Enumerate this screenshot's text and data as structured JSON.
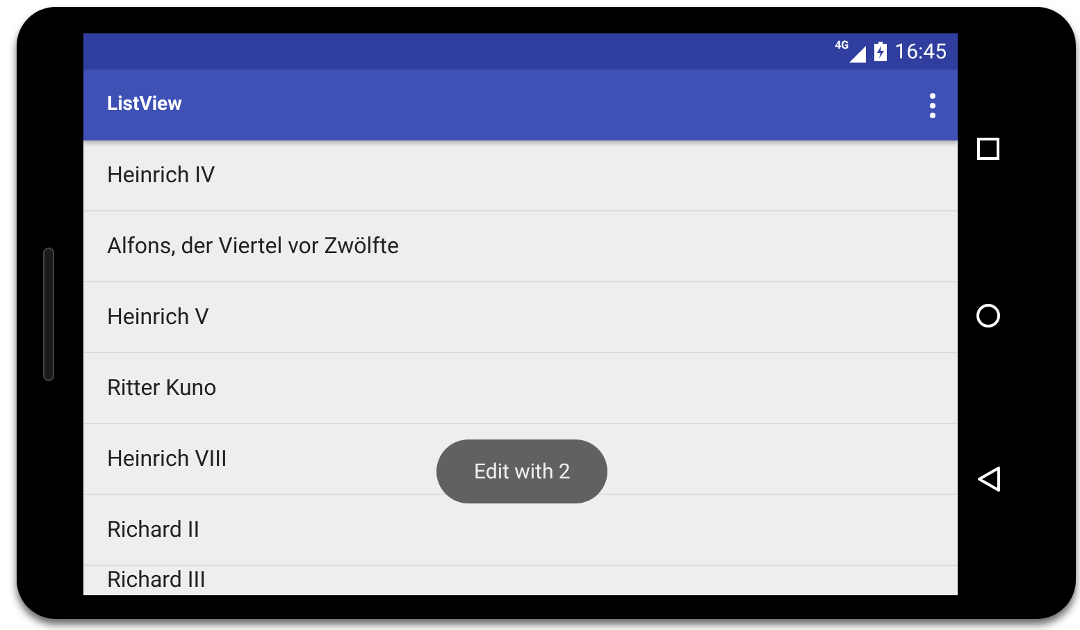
{
  "status_bar": {
    "network": "4G",
    "time": "16:45"
  },
  "toolbar": {
    "title": "ListView"
  },
  "list": [
    {
      "label": "Heinrich IV"
    },
    {
      "label": "Alfons, der Viertel vor Zwölfte"
    },
    {
      "label": "Heinrich V"
    },
    {
      "label": "Ritter Kuno"
    },
    {
      "label": "Heinrich VIII"
    },
    {
      "label": "Richard II"
    },
    {
      "label": "Richard III"
    }
  ],
  "toast": "Edit with 2"
}
